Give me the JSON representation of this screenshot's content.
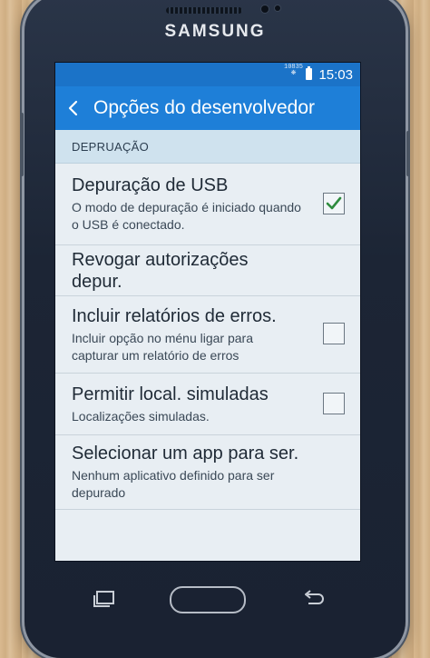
{
  "device": {
    "brand": "SAMSUNG"
  },
  "statusbar": {
    "mini_top": "10835",
    "mini_bottom": "❋",
    "time": "15:03"
  },
  "appbar": {
    "title": "Opções do desenvolvedor"
  },
  "section": {
    "label": "DEPRUAÇÃO"
  },
  "items": [
    {
      "title": "Depuração de USB",
      "subtitle": "O modo de depuração é iniciado quando o USB é conectado.",
      "checked": true
    },
    {
      "title": "Revogar autorizações depur.",
      "subtitle": ""
    },
    {
      "title": "Incluir relatórios de erros.",
      "subtitle": "Incluir opção no ménu ligar para capturar um relatório de erros",
      "checked": false
    },
    {
      "title": "Permitir local. simuladas",
      "subtitle": "Localizações simuladas.",
      "checked": false
    },
    {
      "title": "Selecionar um app para ser.",
      "subtitle": "Nenhum aplicativo definido para ser depurado"
    }
  ],
  "colors": {
    "statusbar": "#1b73c8",
    "appbar": "#1e7fd8",
    "check": "#2e8b3e"
  },
  "icons": [
    "back-arrow-icon",
    "battery-icon",
    "checkmark-icon",
    "recent-apps-icon",
    "home-button",
    "back-key-icon"
  ]
}
